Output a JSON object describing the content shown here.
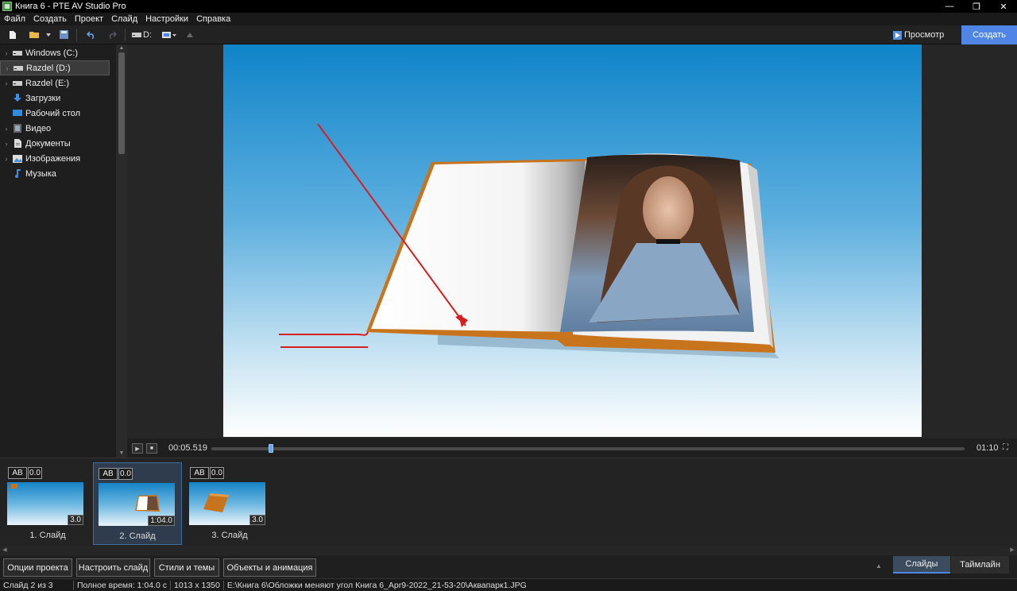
{
  "window": {
    "title": "Книга 6 - PTE AV Studio Pro",
    "controls": [
      "—",
      "❐",
      "✕"
    ]
  },
  "menu": [
    "Файл",
    "Создать",
    "Проект",
    "Слайд",
    "Настройки",
    "Справка"
  ],
  "toolbar": {
    "drive_label": "D:",
    "preview_label": "Просмотр",
    "create_label": "Создать"
  },
  "tree": [
    {
      "label": "Windows (C:)",
      "icon": "drive-icon",
      "expandable": true,
      "selected": false
    },
    {
      "label": "Razdel (D:)",
      "icon": "drive-icon",
      "expandable": true,
      "selected": true
    },
    {
      "label": "Razdel (E:)",
      "icon": "drive-icon",
      "expandable": true,
      "selected": false
    },
    {
      "label": "Загрузки",
      "icon": "download-icon",
      "expandable": false,
      "selected": false
    },
    {
      "label": "Рабочий стол",
      "icon": "desktop-icon",
      "expandable": false,
      "selected": false
    },
    {
      "label": "Видео",
      "icon": "video-icon",
      "expandable": true,
      "selected": false
    },
    {
      "label": "Документы",
      "icon": "document-icon",
      "expandable": true,
      "selected": false
    },
    {
      "label": "Изображения",
      "icon": "image-icon",
      "expandable": true,
      "selected": false
    },
    {
      "label": "Музыка",
      "icon": "music-icon",
      "expandable": false,
      "selected": false
    }
  ],
  "player": {
    "current_time": "00:05.519",
    "total_time": "01:10",
    "progress": 0.079
  },
  "slides": [
    {
      "transition": "AB",
      "transition_time": "0.0",
      "duration": "3.0",
      "label": "1. Слайд",
      "selected": false
    },
    {
      "transition": "AB",
      "transition_time": "0.0",
      "duration": "1:04.0",
      "label": "2. Слайд",
      "selected": true
    },
    {
      "transition": "AB",
      "transition_time": "0.0",
      "duration": "3.0",
      "label": "3. Слайд",
      "selected": false
    }
  ],
  "bottom_buttons": [
    "Опции проекта",
    "Настроить слайд",
    "Стили и темы",
    "Объекты и анимация"
  ],
  "tabs": [
    "Слайды",
    "Таймлайн"
  ],
  "status": {
    "slide_pos": "Слайд 2 из 3",
    "total_time": "Полное время: 1:04.0 с",
    "dimensions": "1013 x 1350",
    "path": "E:\\Книга 6\\Обложки меняют угол Книга 6_Apr9-2022_21-53-20\\Аквапарк1.JPG"
  },
  "colors": {
    "accent": "#4f86e6",
    "annotation_red": "#d81e1e",
    "book_cover": "#c8741c"
  }
}
